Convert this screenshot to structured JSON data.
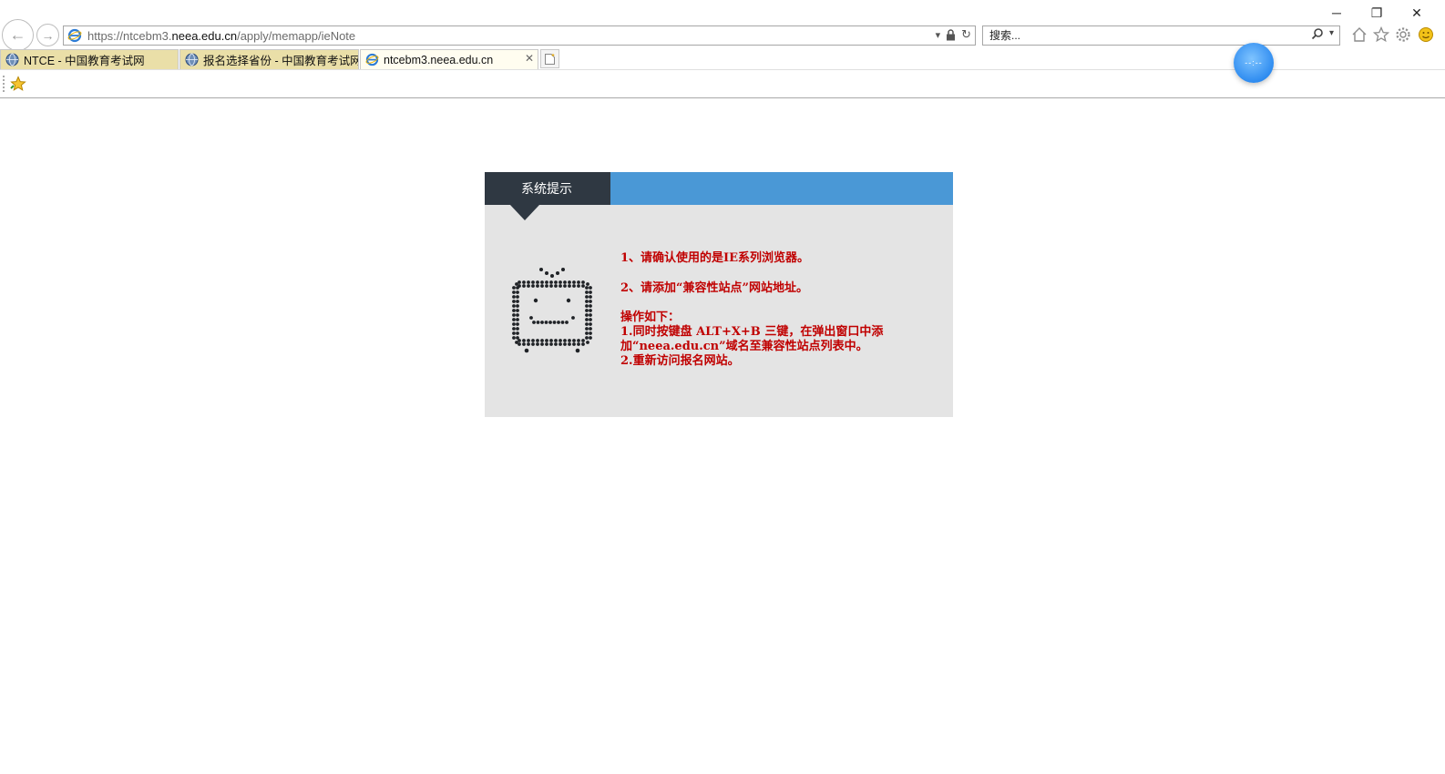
{
  "window": {
    "minimize_label": "─",
    "restore_label": "❐",
    "close_label": "✕"
  },
  "address_bar": {
    "url_prefix": "https://ntcebm3.",
    "url_host": "neea.edu.cn",
    "url_path": "/apply/memapp/ieNote"
  },
  "search": {
    "placeholder": "搜索..."
  },
  "tabs": [
    {
      "label": "NTCE - 中国教育考试网",
      "active": false
    },
    {
      "label": "报名选择省份 - 中国教育考试网",
      "active": false
    },
    {
      "label": "ntcebm3.neea.edu.cn",
      "active": true
    }
  ],
  "tab_close_label": "✕",
  "floating_widget_label": "--:--",
  "notice": {
    "title": "系统提示",
    "line1": "1、请确认使用的是IE系列浏览器。",
    "line2": "2、请添加“兼容性站点”网站地址。",
    "steps_heading": "操作如下：",
    "step1": "1.同时按键盘 ALT+X+B 三键，在弹出窗口中添加“neea.edu.cn”域名至兼容性站点列表中。",
    "step2": "2.重新访问报名网站。"
  },
  "colors": {
    "header_blue": "#4a98d6",
    "title_dark": "#2f3842",
    "card_bg": "#e4e4e4",
    "notice_red": "#c00000",
    "tab_inactive": "#eadfa8"
  }
}
